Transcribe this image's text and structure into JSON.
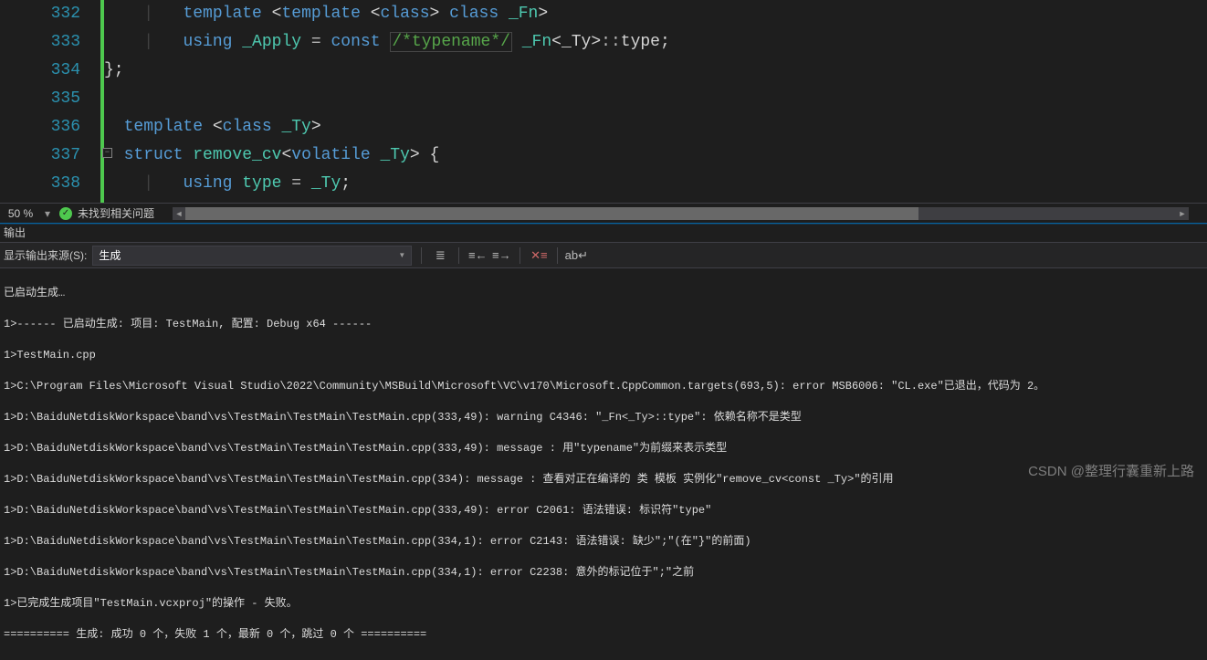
{
  "editor": {
    "lines": [
      332,
      333,
      334,
      335,
      336,
      337,
      338
    ],
    "code": {
      "l332": {
        "indent": "        ",
        "kw1": "template",
        "angle1": " <",
        "kw2": "template",
        "angle2": " <",
        "kw3": "class",
        "angle3": "> ",
        "kw4": "class",
        "name": " _Fn",
        "close": ">"
      },
      "l333": {
        "indent": "        ",
        "kw1": "using",
        "name1": " _Apply ",
        "eq": "=",
        "kw2": " const ",
        "comment": "/*typename*/",
        "name2": " _Fn",
        "angle": "<_Ty>",
        "scope": "::",
        "type": "type",
        "semi": ";"
      },
      "l334": {
        "indent": "    ",
        "close": "};"
      },
      "l335": {
        "indent": ""
      },
      "l336": {
        "indent": "    ",
        "kw1": "template",
        "angle1": " <",
        "kw2": "class",
        "name": " _Ty",
        "close": ">"
      },
      "l337": {
        "indent": "",
        "kw1": "struct",
        "name": " remove_cv",
        "angle": "<",
        "kw2": "volatile",
        "name2": " _Ty",
        "close": "> {"
      },
      "l338": {
        "indent": "        ",
        "kw1": "using",
        "name1": " type ",
        "eq": "=",
        "name2": " _Ty",
        "semi": ";"
      }
    }
  },
  "status": {
    "zoom": "50 %",
    "no_issues": "未找到相关问题"
  },
  "output_panel": {
    "title": "输出",
    "source_label": "显示输出来源(S):",
    "source_value": "生成",
    "lines": [
      "已启动生成…",
      "1>------ 已启动生成: 项目: TestMain, 配置: Debug x64 ------",
      "1>TestMain.cpp",
      "1>C:\\Program Files\\Microsoft Visual Studio\\2022\\Community\\MSBuild\\Microsoft\\VC\\v170\\Microsoft.CppCommon.targets(693,5): error MSB6006: \"CL.exe\"已退出，代码为 2。",
      "1>D:\\BaiduNetdiskWorkspace\\band\\vs\\TestMain\\TestMain\\TestMain.cpp(333,49): warning C4346: \"_Fn<_Ty>::type\": 依赖名称不是类型",
      "1>D:\\BaiduNetdiskWorkspace\\band\\vs\\TestMain\\TestMain\\TestMain.cpp(333,49): message : 用\"typename\"为前缀来表示类型",
      "1>D:\\BaiduNetdiskWorkspace\\band\\vs\\TestMain\\TestMain\\TestMain.cpp(334): message : 查看对正在编译的 类 模板 实例化\"remove_cv<const _Ty>\"的引用",
      "1>D:\\BaiduNetdiskWorkspace\\band\\vs\\TestMain\\TestMain\\TestMain.cpp(333,49): error C2061: 语法错误: 标识符\"type\"",
      "1>D:\\BaiduNetdiskWorkspace\\band\\vs\\TestMain\\TestMain\\TestMain.cpp(334,1): error C2143: 语法错误: 缺少\";\"(在\"}\"的前面)",
      "1>D:\\BaiduNetdiskWorkspace\\band\\vs\\TestMain\\TestMain\\TestMain.cpp(334,1): error C2238: 意外的标记位于\";\"之前",
      "1>已完成生成项目\"TestMain.vcxproj\"的操作 - 失败。",
      "========== 生成: 成功 0 个，失败 1 个，最新 0 个，跳过 0 个 =========="
    ]
  },
  "watermark": "CSDN @整理行囊重新上路"
}
